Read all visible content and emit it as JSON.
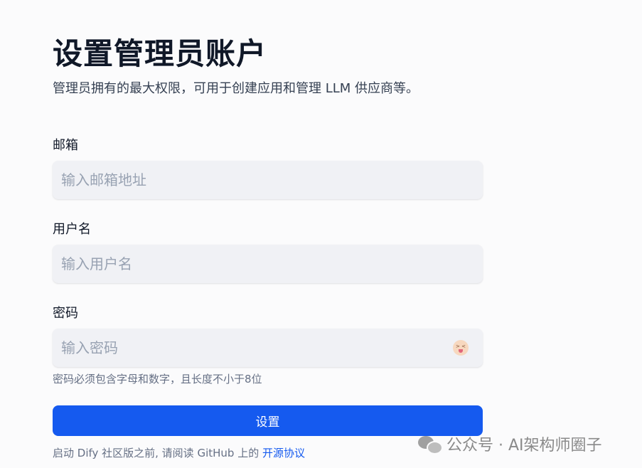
{
  "header": {
    "title": "设置管理员账户",
    "subtitle": "管理员拥有的最大权限，可用于创建应用和管理 LLM 供应商等。"
  },
  "form": {
    "email": {
      "label": "邮箱",
      "placeholder": "输入邮箱地址",
      "value": ""
    },
    "username": {
      "label": "用户名",
      "placeholder": "输入用户名",
      "value": ""
    },
    "password": {
      "label": "密码",
      "placeholder": "输入密码",
      "value": "",
      "toggle_icon": "face-with-tongue-icon",
      "hint": "密码必须包含字母和数字，且长度不小于8位"
    },
    "submit_label": "设置"
  },
  "footer": {
    "text": "启动 Dify 社区版之前, 请阅读 GitHub 上的 ",
    "link_label": "开源协议"
  },
  "watermark": {
    "icon": "wechat-icon",
    "text": "公众号 · AI架构师圈子"
  },
  "colors": {
    "primary": "#155aef",
    "input_bg": "#f0f1f5",
    "text_main": "#101828",
    "text_muted": "#667085"
  }
}
